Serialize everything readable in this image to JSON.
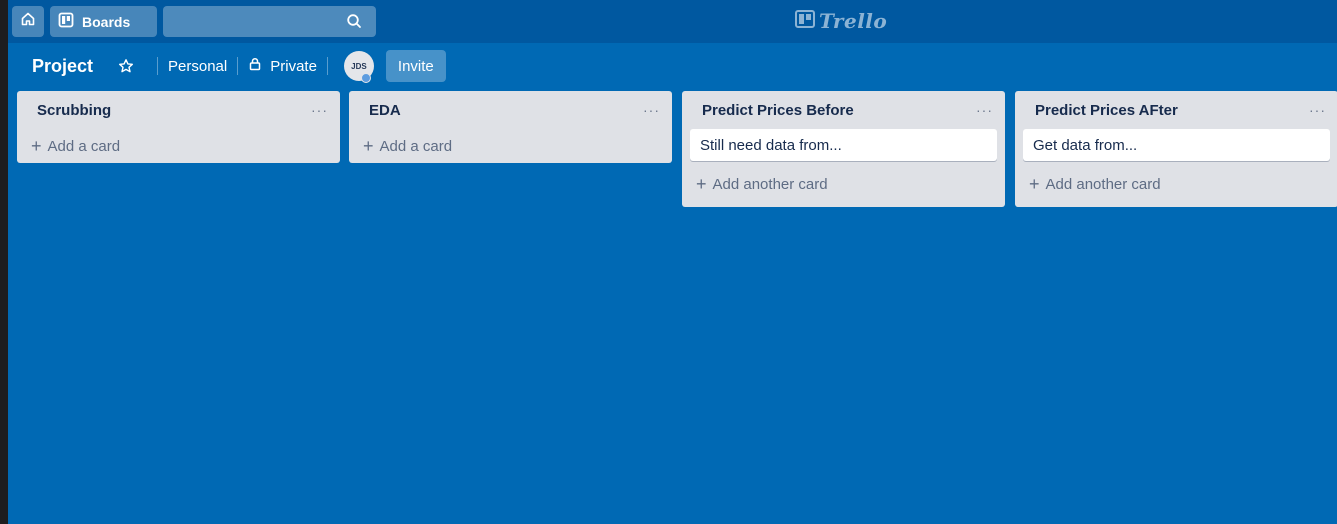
{
  "topbar": {
    "boards_label": "Boards",
    "search_placeholder": "",
    "logo_text": "Trello"
  },
  "board": {
    "title": "Project",
    "visibility_team": "Personal",
    "privacy": "Private",
    "member_initials": "JDS",
    "invite_label": "Invite"
  },
  "lists": [
    {
      "title": "Scrubbing",
      "menu": "···",
      "add_label": "Add a card"
    },
    {
      "title": "EDA",
      "menu": "···",
      "add_label": "Add a card"
    },
    {
      "title": "Predict Prices Before",
      "menu": "···",
      "card": "Still need data from...",
      "add_label": "Add another card"
    },
    {
      "title": "Predict Prices AFter",
      "menu": "···",
      "card": "Get data from...",
      "add_label": "Add another card"
    }
  ],
  "colors": {
    "board_bg": "#0069b4",
    "header_bg": "#0058a0",
    "list_bg": "#dfe1e6"
  },
  "icons": {
    "home": "home-icon",
    "boards": "boards-icon",
    "search": "search-icon",
    "star": "star-icon",
    "lock": "lock-icon",
    "logo": "trello-logo-icon"
  }
}
